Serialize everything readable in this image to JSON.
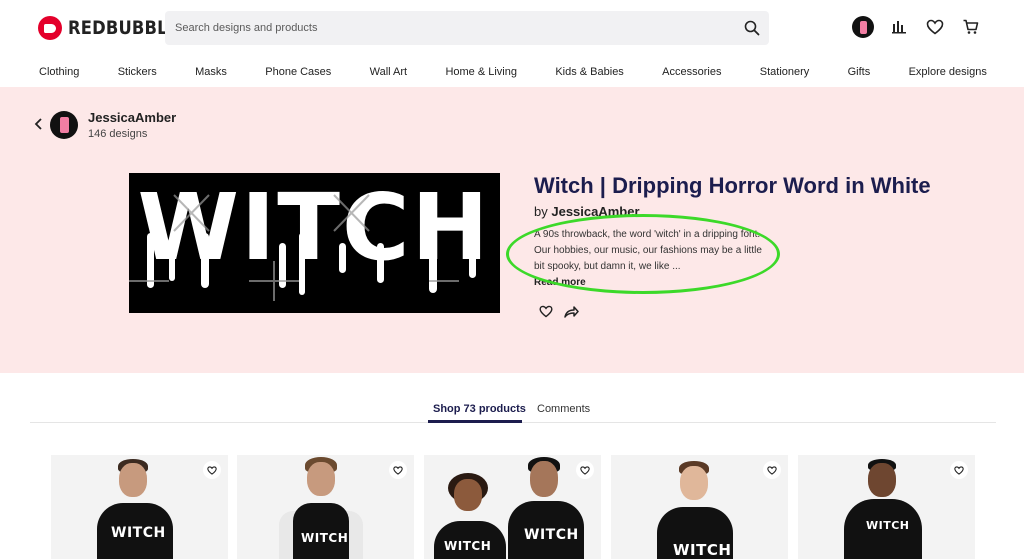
{
  "header": {
    "brand": "REDBUBBLE",
    "search_placeholder": "Search designs and products"
  },
  "nav": {
    "items": [
      "Clothing",
      "Stickers",
      "Masks",
      "Phone Cases",
      "Wall Art",
      "Home & Living",
      "Kids & Babies",
      "Accessories",
      "Stationery",
      "Gifts",
      "Explore designs"
    ]
  },
  "artist": {
    "name": "JessicaAmber",
    "designs_count": "146 designs"
  },
  "design": {
    "artwork_text": "WITCH",
    "title": "Witch | Dripping Horror Word in White",
    "by_prefix": "by",
    "by_name": "JessicaAmber",
    "description": "A 90s throwback, the word 'witch' in a dripping font. Our hobbies, our music, our fashions may be a little bit spooky, but damn it, we like ...",
    "read_more": "Read more"
  },
  "tabs": {
    "shop": "Shop 73 products",
    "comments": "Comments"
  },
  "products": {
    "shirt_text": "WITCH"
  },
  "colors": {
    "brand_red": "#e4002b",
    "hero_bg": "#fde8e8",
    "title_navy": "#1c1d4e",
    "highlight_green": "#3cd929"
  }
}
